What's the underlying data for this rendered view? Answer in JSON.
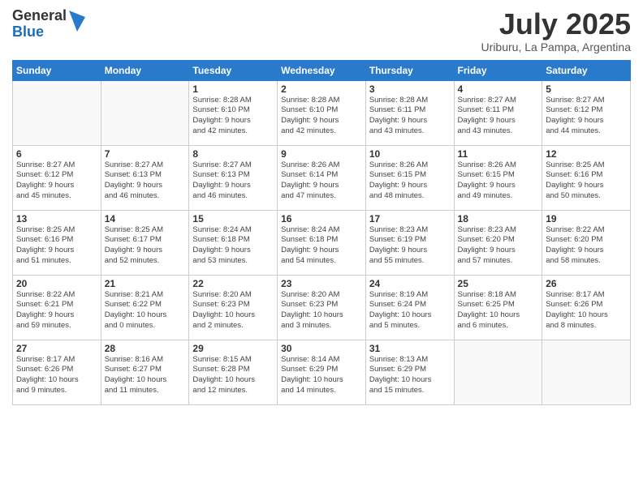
{
  "logo": {
    "general": "General",
    "blue": "Blue"
  },
  "title": "July 2025",
  "subtitle": "Uriburu, La Pampa, Argentina",
  "days_of_week": [
    "Sunday",
    "Monday",
    "Tuesday",
    "Wednesday",
    "Thursday",
    "Friday",
    "Saturday"
  ],
  "weeks": [
    [
      {
        "day": "",
        "info": ""
      },
      {
        "day": "",
        "info": ""
      },
      {
        "day": "1",
        "info": "Sunrise: 8:28 AM\nSunset: 6:10 PM\nDaylight: 9 hours\nand 42 minutes."
      },
      {
        "day": "2",
        "info": "Sunrise: 8:28 AM\nSunset: 6:10 PM\nDaylight: 9 hours\nand 42 minutes."
      },
      {
        "day": "3",
        "info": "Sunrise: 8:28 AM\nSunset: 6:11 PM\nDaylight: 9 hours\nand 43 minutes."
      },
      {
        "day": "4",
        "info": "Sunrise: 8:27 AM\nSunset: 6:11 PM\nDaylight: 9 hours\nand 43 minutes."
      },
      {
        "day": "5",
        "info": "Sunrise: 8:27 AM\nSunset: 6:12 PM\nDaylight: 9 hours\nand 44 minutes."
      }
    ],
    [
      {
        "day": "6",
        "info": "Sunrise: 8:27 AM\nSunset: 6:12 PM\nDaylight: 9 hours\nand 45 minutes."
      },
      {
        "day": "7",
        "info": "Sunrise: 8:27 AM\nSunset: 6:13 PM\nDaylight: 9 hours\nand 46 minutes."
      },
      {
        "day": "8",
        "info": "Sunrise: 8:27 AM\nSunset: 6:13 PM\nDaylight: 9 hours\nand 46 minutes."
      },
      {
        "day": "9",
        "info": "Sunrise: 8:26 AM\nSunset: 6:14 PM\nDaylight: 9 hours\nand 47 minutes."
      },
      {
        "day": "10",
        "info": "Sunrise: 8:26 AM\nSunset: 6:15 PM\nDaylight: 9 hours\nand 48 minutes."
      },
      {
        "day": "11",
        "info": "Sunrise: 8:26 AM\nSunset: 6:15 PM\nDaylight: 9 hours\nand 49 minutes."
      },
      {
        "day": "12",
        "info": "Sunrise: 8:25 AM\nSunset: 6:16 PM\nDaylight: 9 hours\nand 50 minutes."
      }
    ],
    [
      {
        "day": "13",
        "info": "Sunrise: 8:25 AM\nSunset: 6:16 PM\nDaylight: 9 hours\nand 51 minutes."
      },
      {
        "day": "14",
        "info": "Sunrise: 8:25 AM\nSunset: 6:17 PM\nDaylight: 9 hours\nand 52 minutes."
      },
      {
        "day": "15",
        "info": "Sunrise: 8:24 AM\nSunset: 6:18 PM\nDaylight: 9 hours\nand 53 minutes."
      },
      {
        "day": "16",
        "info": "Sunrise: 8:24 AM\nSunset: 6:18 PM\nDaylight: 9 hours\nand 54 minutes."
      },
      {
        "day": "17",
        "info": "Sunrise: 8:23 AM\nSunset: 6:19 PM\nDaylight: 9 hours\nand 55 minutes."
      },
      {
        "day": "18",
        "info": "Sunrise: 8:23 AM\nSunset: 6:20 PM\nDaylight: 9 hours\nand 57 minutes."
      },
      {
        "day": "19",
        "info": "Sunrise: 8:22 AM\nSunset: 6:20 PM\nDaylight: 9 hours\nand 58 minutes."
      }
    ],
    [
      {
        "day": "20",
        "info": "Sunrise: 8:22 AM\nSunset: 6:21 PM\nDaylight: 9 hours\nand 59 minutes."
      },
      {
        "day": "21",
        "info": "Sunrise: 8:21 AM\nSunset: 6:22 PM\nDaylight: 10 hours\nand 0 minutes."
      },
      {
        "day": "22",
        "info": "Sunrise: 8:20 AM\nSunset: 6:23 PM\nDaylight: 10 hours\nand 2 minutes."
      },
      {
        "day": "23",
        "info": "Sunrise: 8:20 AM\nSunset: 6:23 PM\nDaylight: 10 hours\nand 3 minutes."
      },
      {
        "day": "24",
        "info": "Sunrise: 8:19 AM\nSunset: 6:24 PM\nDaylight: 10 hours\nand 5 minutes."
      },
      {
        "day": "25",
        "info": "Sunrise: 8:18 AM\nSunset: 6:25 PM\nDaylight: 10 hours\nand 6 minutes."
      },
      {
        "day": "26",
        "info": "Sunrise: 8:17 AM\nSunset: 6:26 PM\nDaylight: 10 hours\nand 8 minutes."
      }
    ],
    [
      {
        "day": "27",
        "info": "Sunrise: 8:17 AM\nSunset: 6:26 PM\nDaylight: 10 hours\nand 9 minutes."
      },
      {
        "day": "28",
        "info": "Sunrise: 8:16 AM\nSunset: 6:27 PM\nDaylight: 10 hours\nand 11 minutes."
      },
      {
        "day": "29",
        "info": "Sunrise: 8:15 AM\nSunset: 6:28 PM\nDaylight: 10 hours\nand 12 minutes."
      },
      {
        "day": "30",
        "info": "Sunrise: 8:14 AM\nSunset: 6:29 PM\nDaylight: 10 hours\nand 14 minutes."
      },
      {
        "day": "31",
        "info": "Sunrise: 8:13 AM\nSunset: 6:29 PM\nDaylight: 10 hours\nand 15 minutes."
      },
      {
        "day": "",
        "info": ""
      },
      {
        "day": "",
        "info": ""
      }
    ]
  ]
}
